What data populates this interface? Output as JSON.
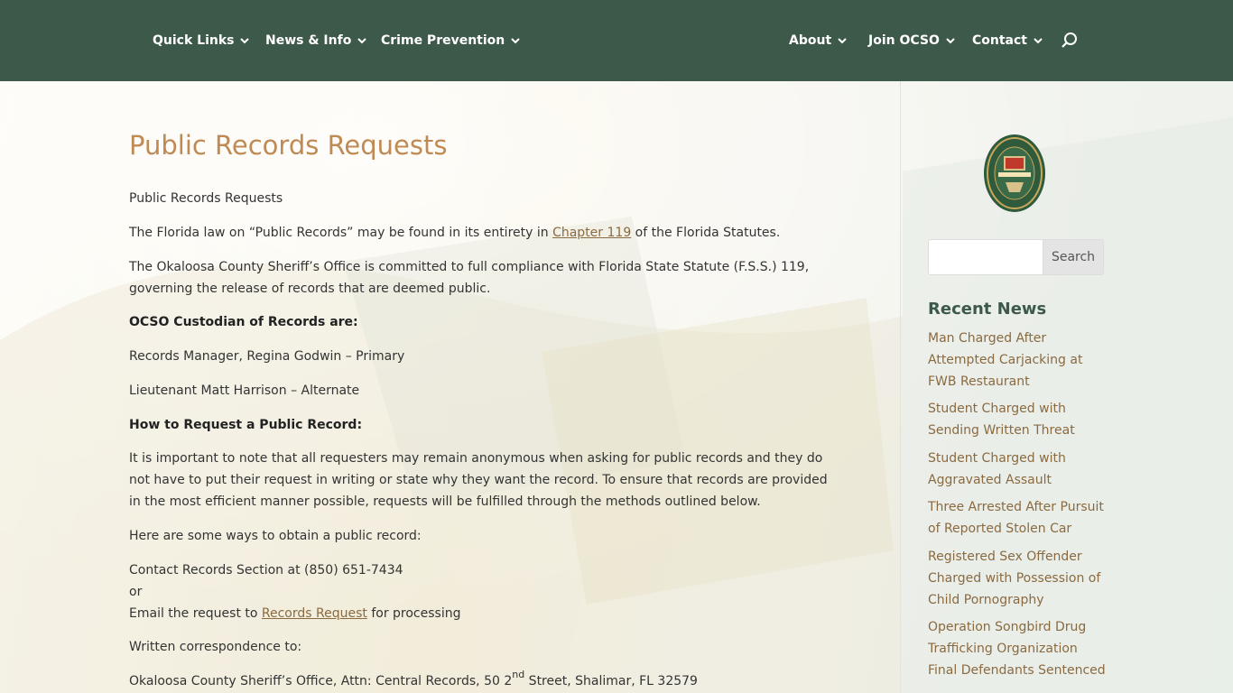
{
  "nav": {
    "left": [
      {
        "label": "Quick Links"
      },
      {
        "label": "News & Info"
      },
      {
        "label": "Crime Prevention"
      }
    ],
    "right": [
      {
        "label": "About"
      },
      {
        "label": "Join OCSO"
      },
      {
        "label": "Contact"
      }
    ]
  },
  "page": {
    "title": "Public Records Requests",
    "intro": "Public Records Requests",
    "law_prefix": "The Florida law on “Public Records” may be found in its entirety in ",
    "law_link": "Chapter 119",
    "law_suffix": "  of the Florida Statutes.",
    "compliance": "The Okaloosa County Sheriff’s Office is committed to full compliance with Florida State Statute (F.S.S.) 119, governing the release of records that are deemed public.",
    "custodian_heading": "OCSO Custodian of Records are:",
    "custodian_primary": "Records Manager, Regina Godwin – Primary",
    "custodian_alternate": "Lieutenant Matt Harrison – Alternate",
    "how_heading": "How to Request a Public Record:",
    "anonymous_note": "It is important to note that all requesters may remain anonymous when asking for public records and they do not have to put their request in writing or state why they want the record.  To ensure that records are provided in the most efficient manner possible, requests will be fulfilled through the methods outlined below.",
    "ways": "Here are some ways to obtain a public record:",
    "contact_phone": "Contact Records Section at (850) 651-7434",
    "or": "or",
    "email_prefix": "Email the request to ",
    "email_link": "Records Request",
    "email_suffix": " for processing",
    "written": "Written correspondence to:",
    "address_prefix": "Okaloosa County Sheriff’s Office, Attn: Central Records, 50 2",
    "address_sup": "nd",
    "address_suffix": " Street, Shalimar, FL 32579"
  },
  "sidebar": {
    "search_button": "Search",
    "search_placeholder": "",
    "recent_title": "Recent News",
    "news": [
      {
        "title": "Man Charged After Attempted Carjacking at FWB Restaurant"
      },
      {
        "title": "Student Charged with Sending Written Threat"
      },
      {
        "title": "Student Charged with Aggravated Assault"
      },
      {
        "title": "Three Arrested After Pursuit of Reported Stolen Car"
      },
      {
        "title": "Registered Sex Offender Charged with Possession of Child Pornography"
      },
      {
        "title": "Operation Songbird Drug Trafficking Organization Final Defendants Sentenced"
      }
    ]
  },
  "colors": {
    "header_bg": "#3c594a",
    "title": "#c08a55",
    "link": "#8a6a40"
  }
}
